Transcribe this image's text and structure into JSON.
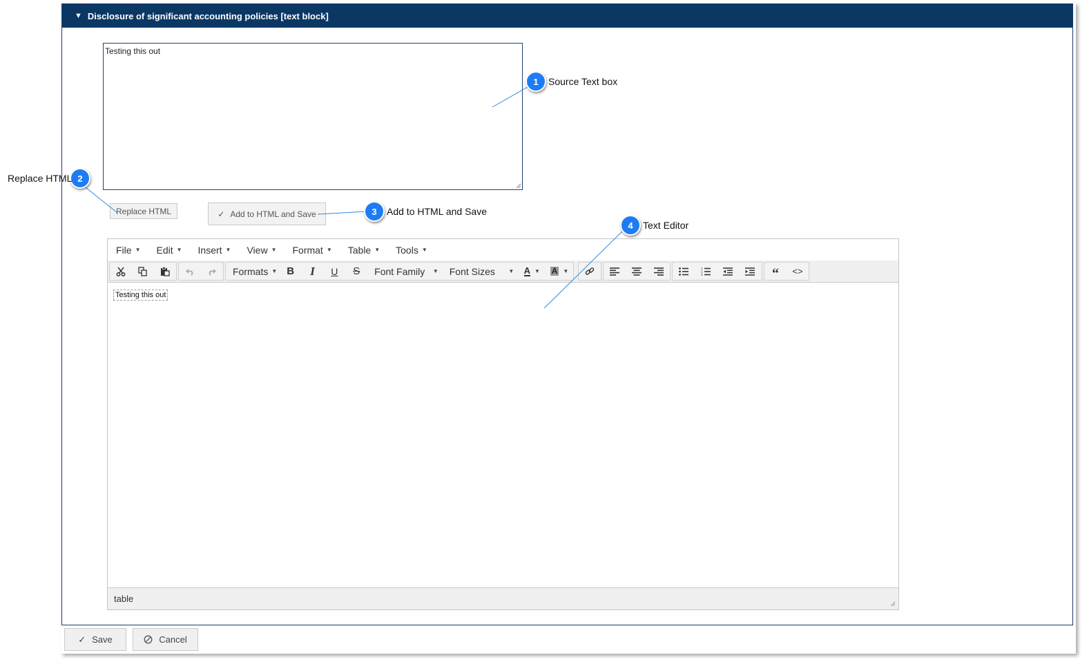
{
  "panel": {
    "title": "Disclosure of significant accounting policies [text block]"
  },
  "source_box": {
    "value": "Testing this out"
  },
  "buttons": {
    "replace_html": "Replace HTML",
    "add_save": "Add to HTML and Save",
    "save": "Save",
    "cancel": "Cancel"
  },
  "editor": {
    "menus": [
      "File",
      "Edit",
      "Insert",
      "View",
      "Format",
      "Table",
      "Tools"
    ],
    "formats_label": "Formats",
    "font_family_label": "Font Family",
    "font_sizes_label": "Font Sizes",
    "content_text": "Testing this out",
    "status_path": "table"
  },
  "callouts": [
    {
      "number": "1",
      "label": "Source Text box"
    },
    {
      "number": "2",
      "label": "Replace HTML"
    },
    {
      "number": "3",
      "label": "Add to HTML and Save"
    },
    {
      "number": "4",
      "label": "Text Editor"
    }
  ],
  "colors": {
    "header_bg": "#0b3764",
    "callout_blue": "#1e7cf2",
    "callout_line": "#2a8ae6"
  },
  "icons": {
    "toolbar": [
      "cut-icon",
      "copy-icon",
      "paste-icon",
      "undo-icon",
      "redo-icon",
      "bold-icon",
      "italic-icon",
      "underline-icon",
      "strikethrough-icon",
      "text-color-icon",
      "background-color-icon",
      "link-icon",
      "align-left-icon",
      "align-center-icon",
      "align-right-icon",
      "bullet-list-icon",
      "numbered-list-icon",
      "outdent-icon",
      "indent-icon",
      "blockquote-icon",
      "code-icon"
    ]
  }
}
